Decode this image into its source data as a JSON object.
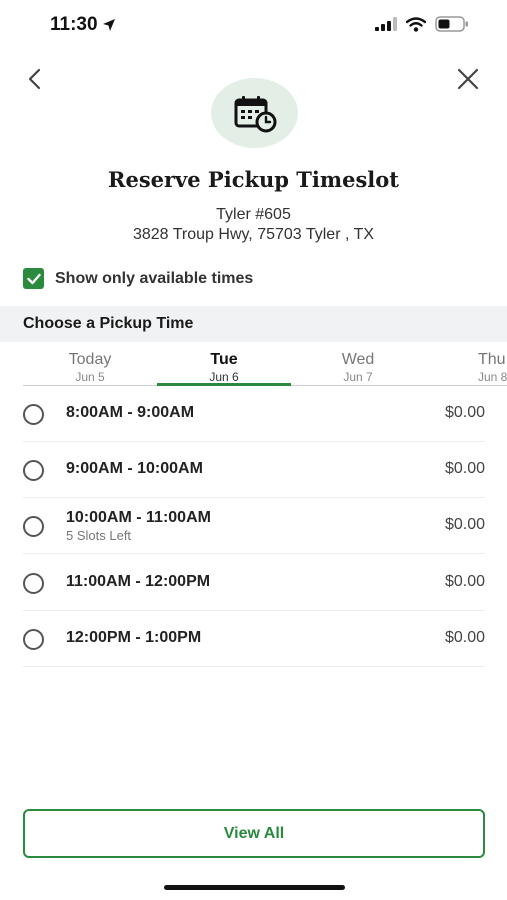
{
  "status_bar": {
    "time": "11:30"
  },
  "header": {
    "title": "Reserve Pickup Timeslot",
    "store_name": "Tyler #605",
    "store_address": "3828 Troup Hwy, 75703 Tyler , TX"
  },
  "filter": {
    "label": "Show only available times",
    "checked": true
  },
  "section": {
    "title": "Choose a Pickup Time"
  },
  "date_tabs": [
    {
      "day": "Today",
      "date": "Jun 5",
      "active": false
    },
    {
      "day": "Tue",
      "date": "Jun 6",
      "active": true
    },
    {
      "day": "Wed",
      "date": "Jun 7",
      "active": false
    },
    {
      "day": "Thu",
      "date": "Jun 8",
      "active": false
    }
  ],
  "slots": [
    {
      "time": "8:00AM - 9:00AM",
      "note": "",
      "price": "$0.00"
    },
    {
      "time": "9:00AM - 10:00AM",
      "note": "",
      "price": "$0.00"
    },
    {
      "time": "10:00AM - 11:00AM",
      "note": "5 Slots Left",
      "price": "$0.00"
    },
    {
      "time": "11:00AM - 12:00PM",
      "note": "",
      "price": "$0.00"
    },
    {
      "time": "12:00PM - 1:00PM",
      "note": "",
      "price": "$0.00"
    }
  ],
  "footer": {
    "view_all_label": "View All"
  },
  "colors": {
    "accent": "#2a8a3e",
    "icon_bg": "#e3efe6",
    "section_bg": "#f1f2f3"
  },
  "icons": [
    "location-arrow-icon",
    "signal-icon",
    "wifi-icon",
    "battery-icon",
    "back-chevron-icon",
    "close-icon",
    "calendar-clock-icon",
    "checkmark-icon"
  ]
}
